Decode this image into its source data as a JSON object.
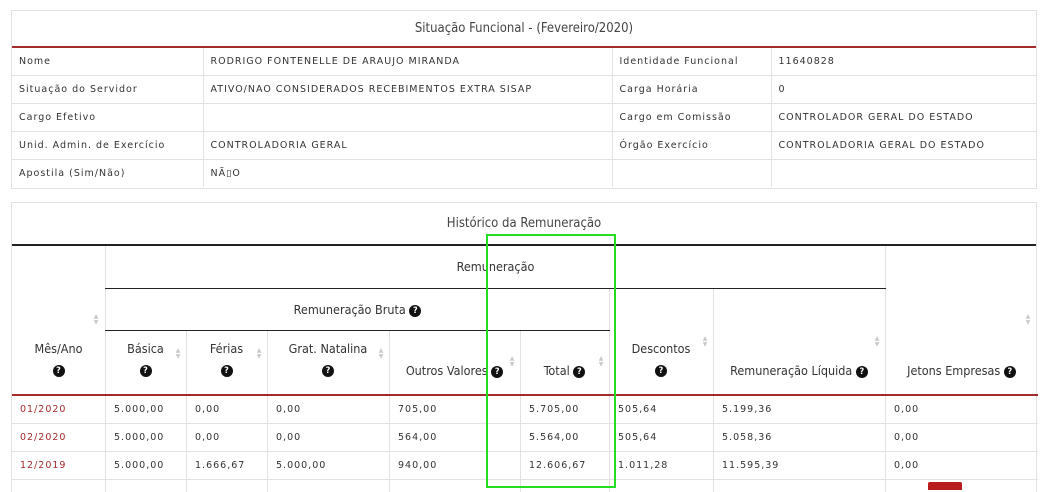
{
  "situacao": {
    "title": "Situação Funcional - (Fevereiro/2020)",
    "rows": [
      {
        "l1": "Nome",
        "v1": "RODRIGO FONTENELLE DE ARAUJO MIRANDA",
        "l2": "Identidade Funcional",
        "v2": "11640828"
      },
      {
        "l1": "Situação do Servidor",
        "v1": "ATIVO/NAO CONSIDERADOS RECEBIMENTOS EXTRA SISAP",
        "l2": "Carga Horária",
        "v2": "0"
      },
      {
        "l1": "Cargo Efetivo",
        "v1": "",
        "l2": "Cargo em Comissão",
        "v2": "CONTROLADOR GERAL DO ESTADO"
      },
      {
        "l1": "Unid. Admin. de Exercício",
        "v1": "CONTROLADORIA GERAL",
        "l2": "Órgão Exercício",
        "v2": "CONTROLADORIA GERAL DO ESTADO"
      },
      {
        "l1": "Apostila (Sim/Não)",
        "v1": "NÃ▯O",
        "l2": "",
        "v2": ""
      }
    ]
  },
  "historico": {
    "title": "Histórico da Remuneração",
    "group_remuneracao": "Remuneração",
    "group_bruta": "Remuneração Bruta",
    "headers": {
      "mes_ano": "Mês/Ano",
      "basica": "Básica",
      "ferias": "Férias",
      "grat_natalina": "Grat. Natalina",
      "outros_valores": "Outros Valores",
      "total": "Total",
      "descontos": "Descontos",
      "liquida": "Remuneração Líquida",
      "jetons": "Jetons Empresas"
    },
    "rows": [
      {
        "mes_ano": "01/2020",
        "basica": "5.000,00",
        "ferias": "0,00",
        "grat": "0,00",
        "outros": "705,00",
        "total": "5.705,00",
        "descontos": "505,64",
        "liquida": "5.199,36",
        "jetons": "0,00"
      },
      {
        "mes_ano": "02/2020",
        "basica": "5.000,00",
        "ferias": "0,00",
        "grat": "0,00",
        "outros": "564,00",
        "total": "5.564,00",
        "descontos": "505,64",
        "liquida": "5.058,36",
        "jetons": "0,00"
      },
      {
        "mes_ano": "12/2019",
        "basica": "5.000,00",
        "ferias": "1.666,67",
        "grat": "5.000,00",
        "outros": "940,00",
        "total": "12.606,67",
        "descontos": "1.011,28",
        "liquida": "11.595,39",
        "jetons": "0,00"
      }
    ]
  },
  "icons": {
    "help": "question-circle-icon",
    "sort": "sort-icon"
  },
  "colors": {
    "accent": "#a52a2a",
    "highlight": "#22dd22",
    "button": "#b81c1c"
  }
}
